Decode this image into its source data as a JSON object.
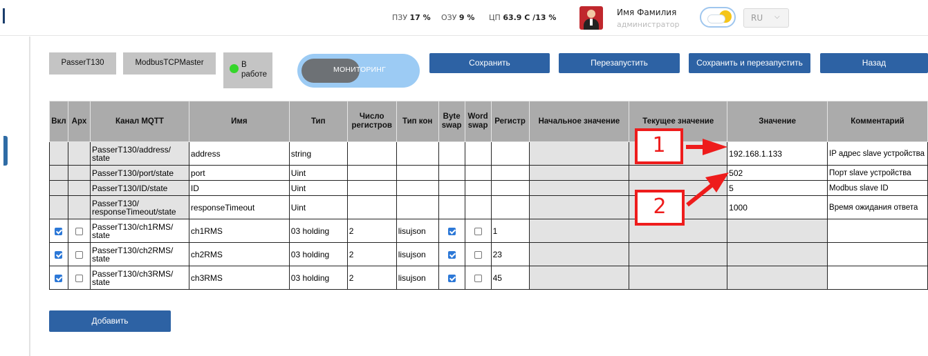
{
  "header": {
    "rom_label": "ПЗУ",
    "rom_value": "17 %",
    "ram_label": "ОЗУ",
    "ram_value": "9 %",
    "cpu_label": "ЦП",
    "cpu_value": "63.9 С /13 %",
    "user_name": "Имя Фамилия",
    "user_role": "администратор",
    "language": "RU"
  },
  "toolbar": {
    "device": "PasserT130",
    "driver": "ModbusTCPMaster",
    "status_line1": "В",
    "status_line2": "работе",
    "mode_label": "МОНИТОРИНГ",
    "save": "Сохранить",
    "restart": "Перезапустить",
    "save_restart": "Сохранить и перезапустить",
    "back": "Назад"
  },
  "table": {
    "headers": {
      "enabled": "Вкл",
      "archive": "Арх",
      "channel": "Канал MQTT",
      "name": "Имя",
      "type": "Тип",
      "reg_count": "Число регистров",
      "conn_type": "Тип кон",
      "byte_swap": "Byte swap",
      "word_swap": "Word swap",
      "register": "Регистр",
      "initial": "Начальное значение",
      "current": "Текущее значение",
      "value": "Значение",
      "comment": "Комментарий"
    },
    "rows": [
      {
        "channel": "PasserT130/address/ state",
        "name": "address",
        "type": "string",
        "reg_count": "",
        "conn_type": "",
        "register": "",
        "value": "192.168.1.133",
        "comment": "IP адрес slave устройства"
      },
      {
        "channel": "PasserT130/port/state",
        "name": "port",
        "type": "Uint",
        "reg_count": "",
        "conn_type": "",
        "register": "",
        "value": "502",
        "comment": "Порт slave устройства"
      },
      {
        "channel": "PasserT130/ID/state",
        "name": "ID",
        "type": "Uint",
        "reg_count": "",
        "conn_type": "",
        "register": "",
        "value": "5",
        "comment": "Modbus slave ID"
      },
      {
        "channel": "PasserT130/ responseTimeout/state",
        "name": "responseTimeout",
        "type": "Uint",
        "reg_count": "",
        "conn_type": "",
        "register": "",
        "value": "1000",
        "comment": "Время ожидания ответа"
      },
      {
        "channel": "PasserT130/ch1RMS/ state",
        "name": "ch1RMS",
        "type": "03 holding",
        "reg_count": "2",
        "conn_type": "lisujson",
        "register": "1",
        "value": "",
        "comment": "",
        "enabled": true,
        "archive": false,
        "byte_swap": true,
        "word_swap": false
      },
      {
        "channel": "PasserT130/ch2RMS/ state",
        "name": "ch2RMS",
        "type": "03 holding",
        "reg_count": "2",
        "conn_type": "lisujson",
        "register": "23",
        "value": "",
        "comment": "",
        "enabled": true,
        "archive": false,
        "byte_swap": true,
        "word_swap": false
      },
      {
        "channel": "PasserT130/ch3RMS/ state",
        "name": "ch3RMS",
        "type": "03 holding",
        "reg_count": "2",
        "conn_type": "lisujson",
        "register": "45",
        "value": "",
        "comment": "",
        "enabled": true,
        "archive": false,
        "byte_swap": true,
        "word_swap": false
      }
    ]
  },
  "annotations": {
    "first": "1",
    "second": "2",
    "color": "#ee1c1c"
  },
  "add_button": "Добавить",
  "colors": {
    "primary_button": "#2d62a4",
    "toggle": "#9ccbf4",
    "status_ok": "#35d62b",
    "table_header": "#ababab"
  }
}
